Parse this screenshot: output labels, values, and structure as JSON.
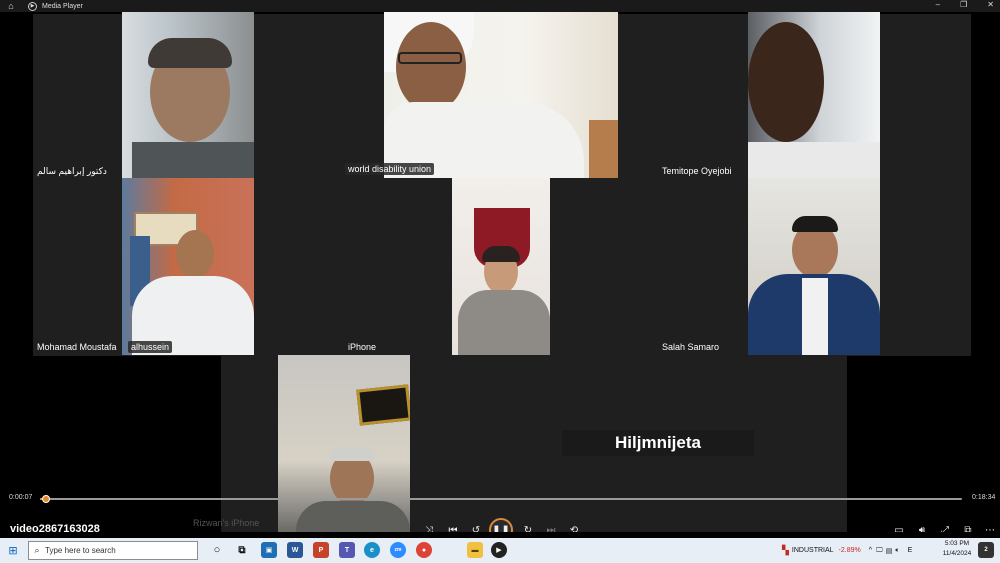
{
  "window": {
    "title": "Media Player",
    "minimize_icon": "–",
    "restore_icon": "❐",
    "close_icon": "✕"
  },
  "participants": [
    {
      "name": "دكتور إبراهيم سالم"
    },
    {
      "name": "world disability union"
    },
    {
      "name": "Temitope Oyejobi"
    },
    {
      "name": "Mohamad Moustafa"
    },
    {
      "name": "alhussein"
    },
    {
      "name": "iPhone"
    },
    {
      "name": "Salah Samaro"
    },
    {
      "name": "Rizwan's iPhone"
    },
    {
      "name": "Hiljmnijeta"
    }
  ],
  "player": {
    "video_title": "video2867163028",
    "current_time": "0:00:07",
    "total_time": "0:18:34",
    "progress_fraction": 0.006
  },
  "taskbar": {
    "search_placeholder": "Type here to search",
    "stock_name": "INDUSTRIAL",
    "stock_change": "-2.89%",
    "time": "5:03 PM",
    "date": "11/4/2024",
    "notification_count": "2"
  },
  "colors": {
    "accent": "#e08a2a",
    "stock_negative": "#c62828"
  }
}
